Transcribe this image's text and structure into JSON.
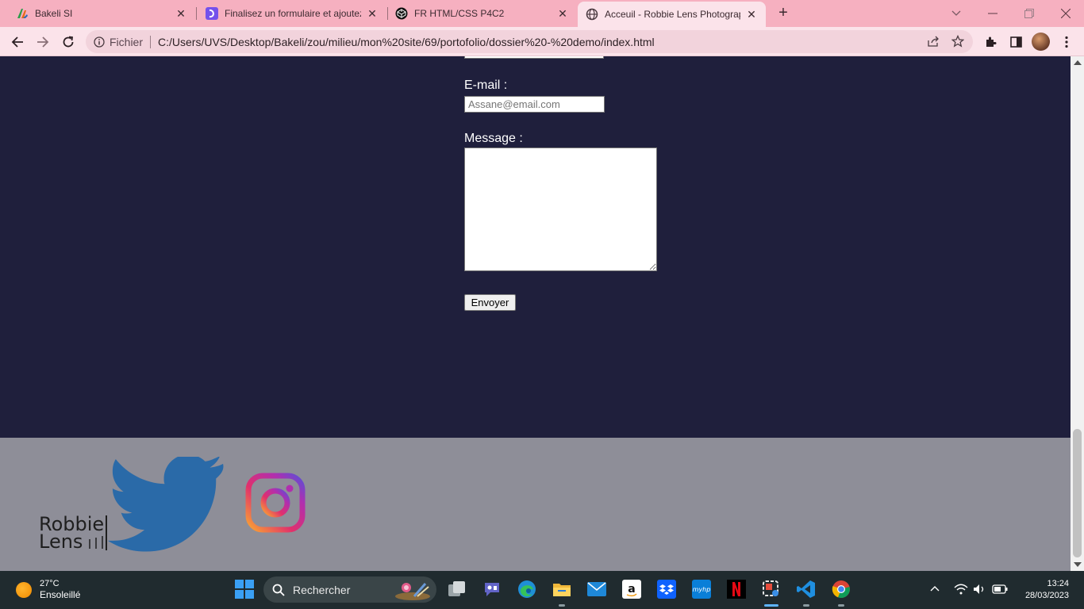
{
  "tabs": [
    {
      "title": "Bakeli SI",
      "favicon": "bakeli-logo-icon"
    },
    {
      "title": "Finalisez un formulaire et ajoutez",
      "favicon": "openclassrooms-icon"
    },
    {
      "title": "FR HTML/CSS P4C2",
      "favicon": "codepen-icon"
    },
    {
      "title": "Acceuil - Robbie Lens Photograph",
      "favicon": "globe-icon",
      "active": true
    }
  ],
  "address_bar": {
    "scheme_label": "Fichier",
    "url": "C:/Users/UVS/Desktop/Bakeli/zou/milieu/mon%20site/69/portofolio/dossier%20-%20demo/index.html"
  },
  "form": {
    "email_label": "E-mail :",
    "email_placeholder": "Assane@email.com",
    "message_label": "Message :",
    "submit_label": "Envoyer"
  },
  "footer": {
    "logo_line1": "Robbie",
    "logo_line2": "Lens",
    "social": [
      "twitter-icon",
      "instagram-icon"
    ]
  },
  "taskbar": {
    "weather_temp": "27°C",
    "weather_desc": "Ensoleillé",
    "search_label": "Rechercher",
    "time": "13:24",
    "date": "28/03/2023"
  },
  "colors": {
    "tabstrip": "#f6b0c0",
    "toolbar": "#fbe3ea",
    "section_dark": "#1f1f3c",
    "footer": "#8e8e98",
    "twitter": "#2a6aa8",
    "taskbar": "#202b2f"
  }
}
